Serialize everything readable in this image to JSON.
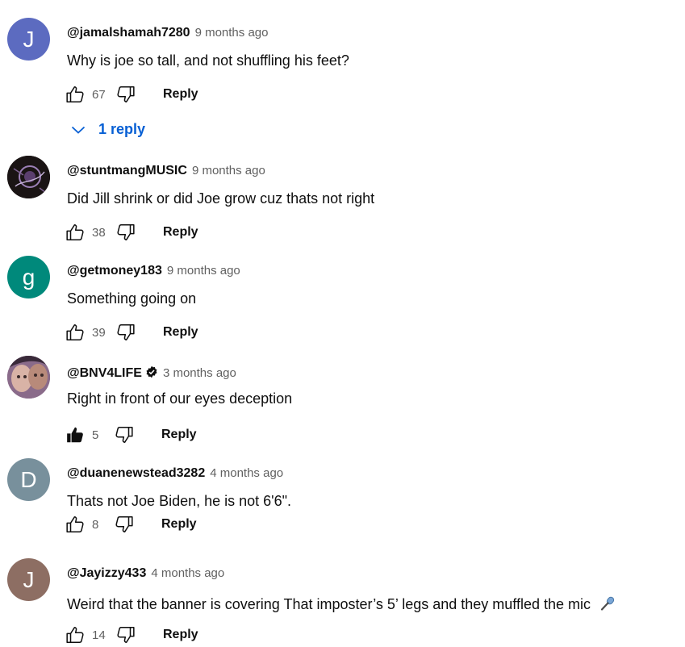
{
  "ui": {
    "reply_label": "Reply"
  },
  "comments": [
    {
      "author": "@jamalshamah7280",
      "time": "9 months ago",
      "text": "Why is joe so tall, and not shuffling his feet?",
      "likes": "67",
      "avatar_letter": "J",
      "avatar_color": "#5c6bc0",
      "replies_label": "1 reply"
    },
    {
      "author": "@stuntmangMUSIC",
      "time": "9 months ago",
      "text": "Did Jill shrink or did Joe grow cuz thats not right",
      "likes": "38",
      "avatar_color": "#1a1414"
    },
    {
      "author": "@getmoney183",
      "time": "9 months ago",
      "text": "Something going on",
      "likes": "39",
      "avatar_letter": "g",
      "avatar_color": "#00897b"
    },
    {
      "author": "@BNV4LIFE",
      "time": "3 months ago",
      "text": "Right in front of our eyes deception",
      "likes": "5",
      "avatar_color": "#6a4a6a",
      "liked": true,
      "verified": true
    },
    {
      "author": "@duanenewstead3282",
      "time": "4 months ago",
      "text": "Thats not Joe Biden, he is not 6'6\".",
      "likes": "8",
      "avatar_letter": "D",
      "avatar_color": "#78909c"
    },
    {
      "author": "@Jayizzy433",
      "time": "4 months ago",
      "text": "Weird that the banner is covering That imposter’s 5’ legs and they muffled the mic",
      "likes": "14",
      "avatar_letter": "J",
      "avatar_color": "#8d6e63"
    }
  ]
}
